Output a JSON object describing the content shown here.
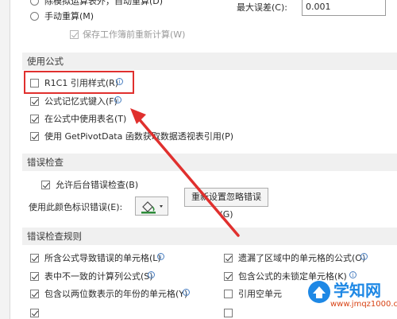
{
  "calculation": {
    "iteration_label_partial": "除模拟运算表外，自动重算(D)",
    "manual_label": "手动重算(M)",
    "recalc_before_save_label": "保存工作簿前重新计算(W)",
    "max_change_label": "最大误差(C):",
    "max_change_value": "0.001"
  },
  "formulas": {
    "header": "使用公式",
    "items": [
      {
        "label": "R1C1 引用样式(R)",
        "checked": false
      },
      {
        "label": "公式记忆式键入(F)",
        "checked": true
      },
      {
        "label": "在公式中使用表名(T)",
        "checked": true
      },
      {
        "label": "使用 GetPivotData 函数获取数据透视表引用(P)",
        "checked": true
      }
    ]
  },
  "error_checking": {
    "header": "错误检查",
    "background_label": "允许后台错误检查(B)",
    "color_label": "使用此颜色标识错误(E):",
    "reset_button": "重新设置忽略错误(G)"
  },
  "error_rules": {
    "header": "错误检查规则",
    "left": [
      {
        "label": "所含公式导致错误的单元格(L)",
        "checked": true
      },
      {
        "label": "表中不一致的计算列公式(S)",
        "checked": true
      },
      {
        "label": "包含以两位数表示的年份的单元格(Y)",
        "checked": true
      }
    ],
    "right": [
      {
        "label": "遗漏了区域中的单元格的公式(O)",
        "checked": true
      },
      {
        "label": "包含公式的未锁定单元格(K)",
        "checked": true
      },
      {
        "label": "引用空单元",
        "checked": false
      }
    ]
  },
  "watermark": {
    "brand": "学知网",
    "url": "www.jmqz1000.com"
  },
  "colors": {
    "highlight": "#e0302e",
    "arrow": "#e0302e",
    "info": "#4a7fc1"
  }
}
